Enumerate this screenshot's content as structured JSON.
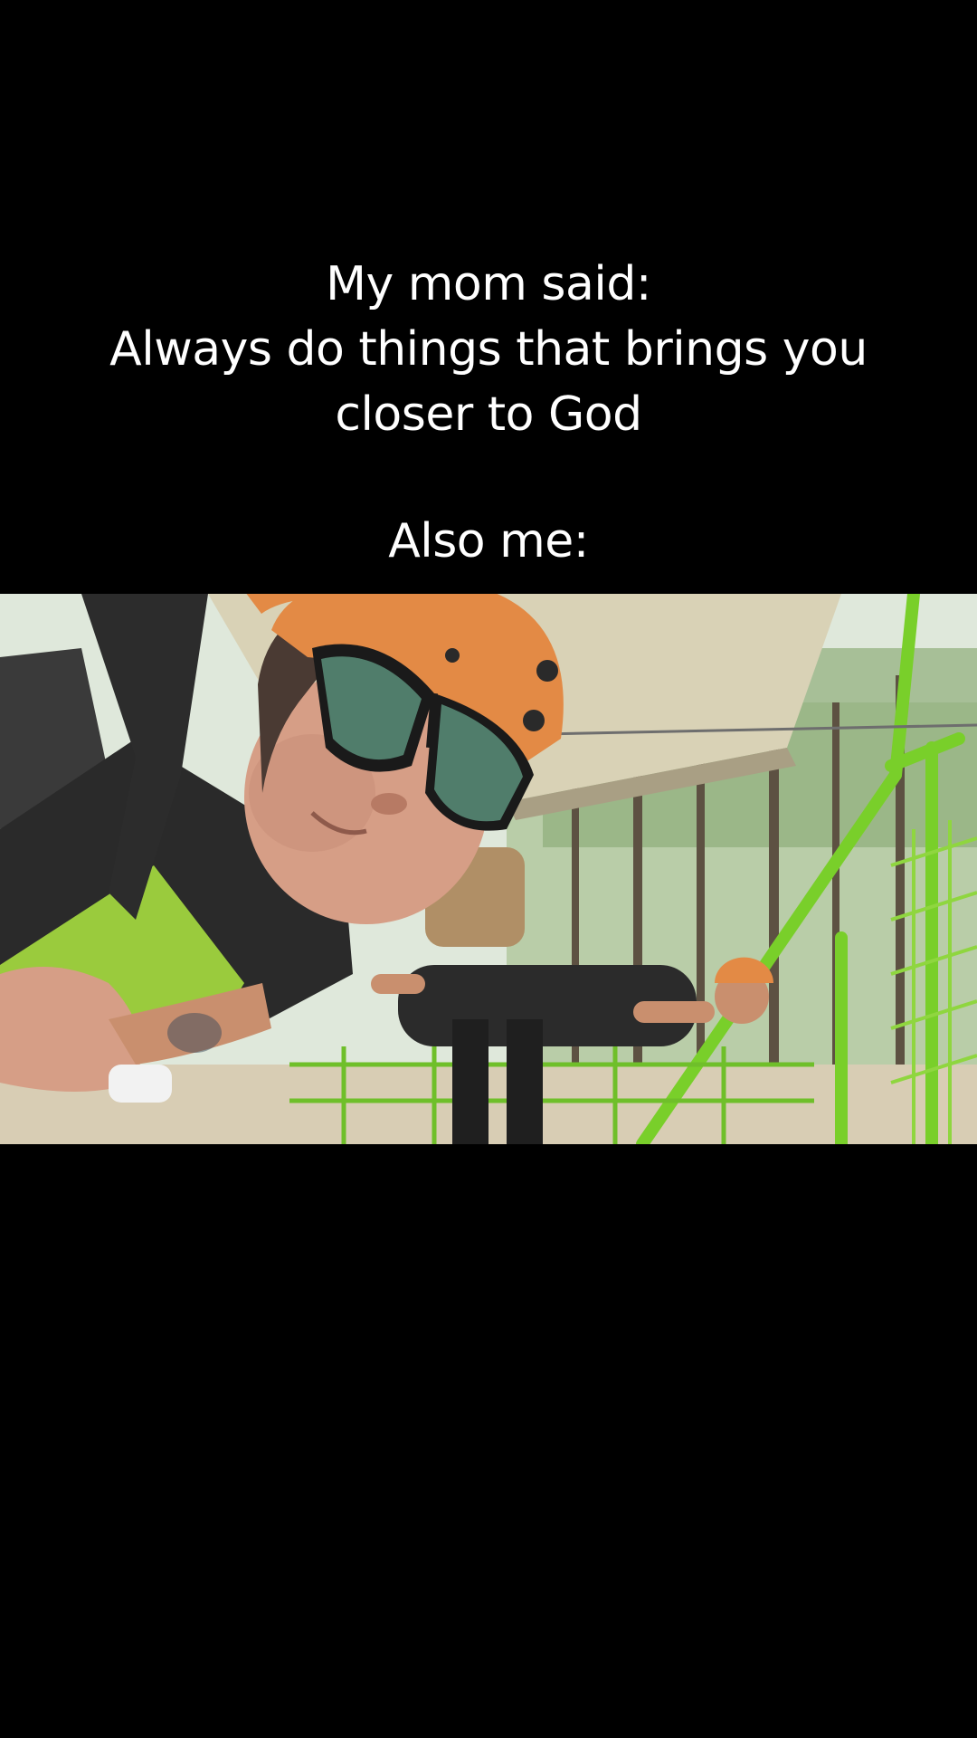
{
  "caption": {
    "line1": "My mom said:",
    "line2": "Always do things that brings you",
    "line3": "closer to God",
    "line4": "Also me:"
  },
  "photo": {
    "subject": "zipline-selfie",
    "colors": {
      "helmet": "#e38a45",
      "vest": "#9acb3d",
      "rail": "#7ed42a",
      "canopy": "#dcd6bd",
      "background": "#000000"
    }
  }
}
